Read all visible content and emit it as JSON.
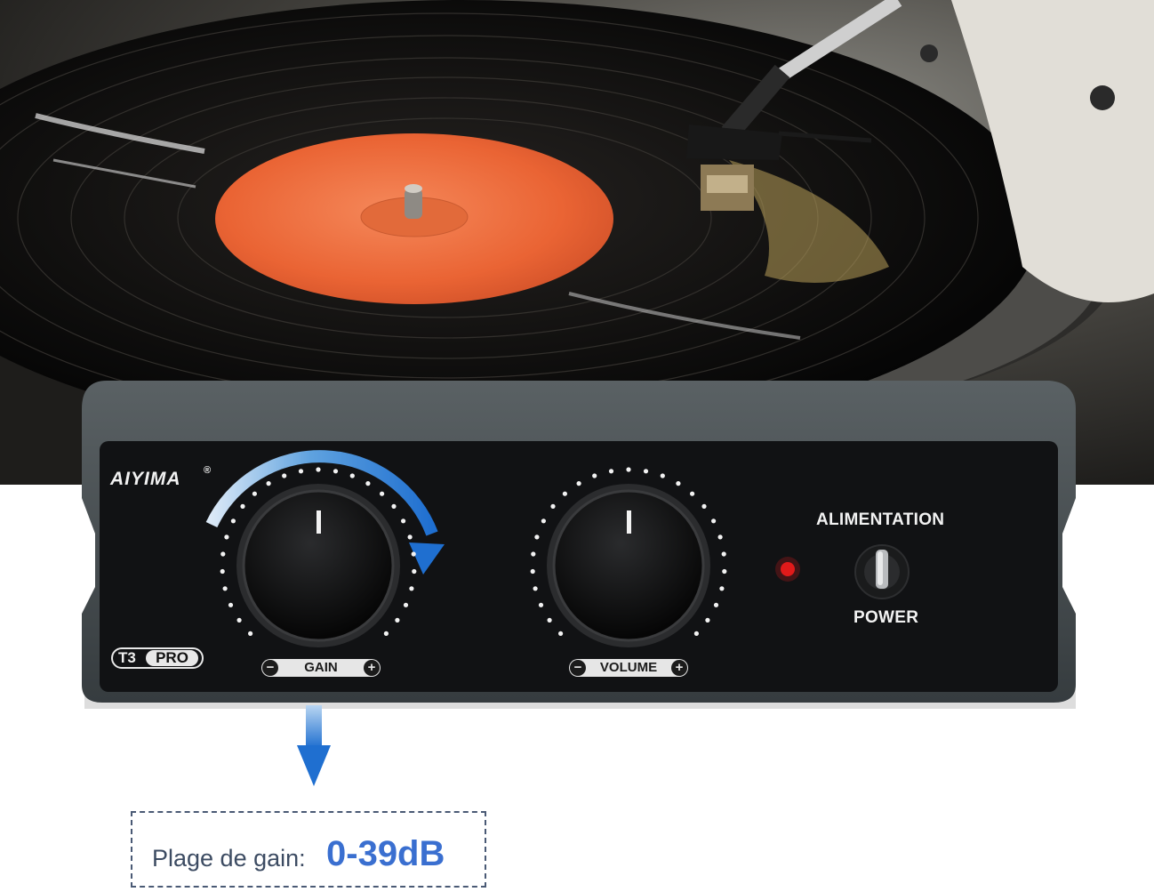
{
  "device": {
    "brand": "AIYIMA",
    "brand_mark": "®",
    "model_prefix": "T3",
    "model_suffix": "PRO",
    "knobs": {
      "gain": {
        "label": "GAIN",
        "minus": "−",
        "plus": "+"
      },
      "volume": {
        "label": "VOLUME",
        "minus": "−",
        "plus": "+"
      }
    },
    "power_label_top": "ALIMENTATION",
    "power_label_bottom": "POWER"
  },
  "callout": {
    "label": "Plage de gain:",
    "value": "0-39dB"
  },
  "colors": {
    "device_face": "#111214",
    "device_shell": "#3d4346",
    "accent_blue": "#2f7fd4",
    "label_orange": "#ef6a3a",
    "led_red": "#e01a1a",
    "callout_value": "#3a6fd0",
    "callout_text": "#3c4b62"
  }
}
